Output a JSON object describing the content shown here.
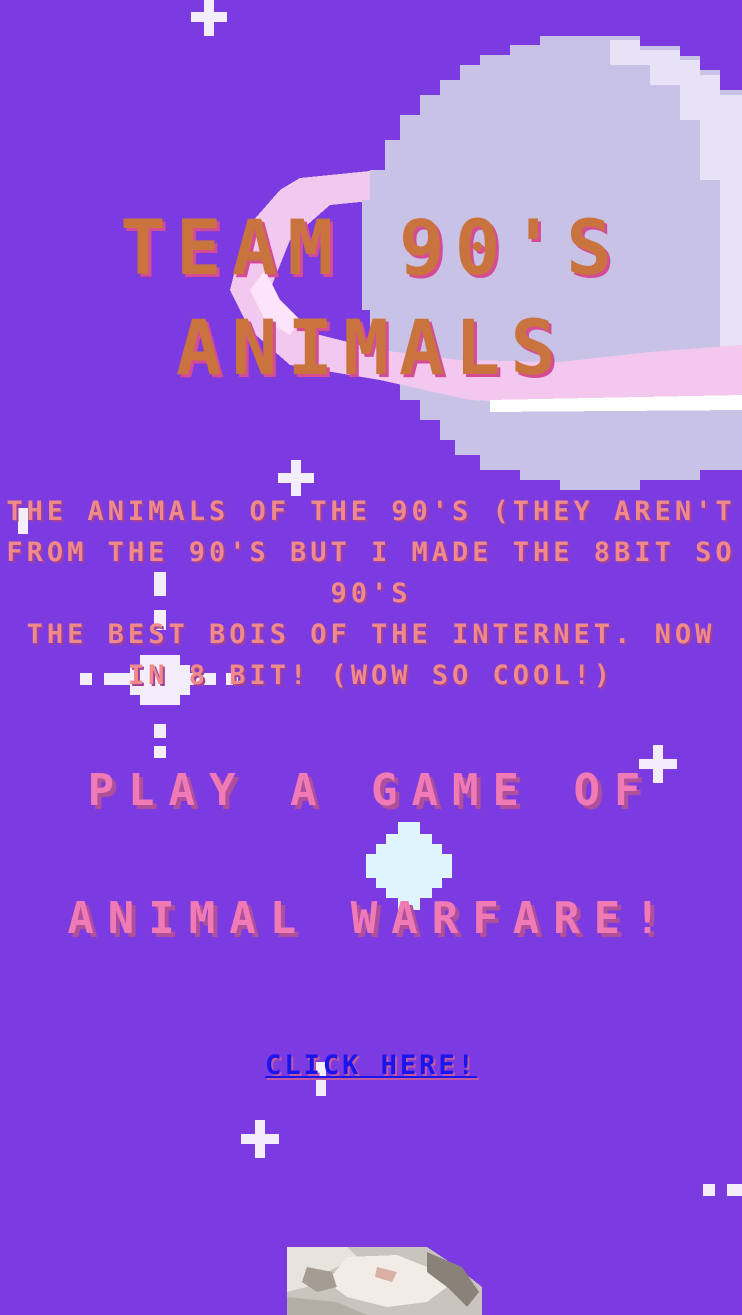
{
  "page": {
    "background_color": "#7b3be0",
    "title_color": "#c9743f",
    "text_color": "#f08a8a",
    "play_color": "#f07ab5",
    "link_color": "#1a14ee"
  },
  "header": {
    "title_line1": "TEAM 90'S",
    "title_line2": "ANIMALS"
  },
  "description": {
    "lines": [
      "THE ANIMALS OF THE 90'S (THEY AREN'T",
      "FROM THE 90'S BUT I MADE THE 8BIT SO",
      "90'S",
      "THE BEST BOIS OF THE INTERNET. NOW",
      "IN 8 BIT! (WOW SO COOL!)"
    ]
  },
  "game": {
    "line1": "PLAY A GAME OF",
    "line2": "ANIMAL WARFARE!",
    "link_label": "CLICK HERE!"
  },
  "decorations": {
    "planet": "pixel-planet",
    "stars": "pixel-sparkles",
    "animal": "pixel-cat-photo"
  }
}
